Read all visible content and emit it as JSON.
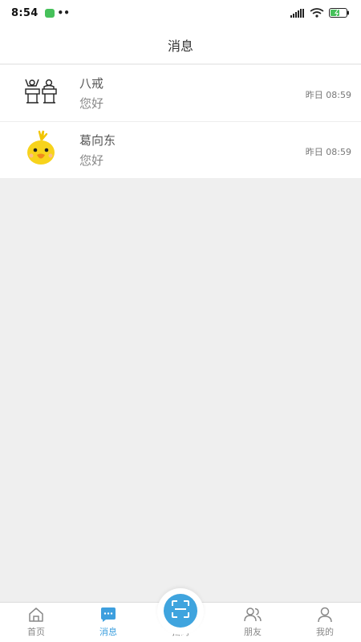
{
  "status_bar": {
    "time": "8:54",
    "dots": "••",
    "accent": "#46c15a"
  },
  "header": {
    "title": "消息"
  },
  "messages": [
    {
      "name": "八戒",
      "preview": "您好",
      "time": "昨日 08:59",
      "avatar_icon": "podium-people-icon"
    },
    {
      "name": "葛向东",
      "preview": "您好",
      "time": "昨日 08:59",
      "avatar_icon": "yellow-bird-icon"
    }
  ],
  "bottom_nav": {
    "active_color": "#3d9fde",
    "items": [
      {
        "label": "首页",
        "icon": "home-icon"
      },
      {
        "label": "消息",
        "icon": "chat-icon",
        "active": true
      },
      {
        "label": "扫码",
        "icon": "scan-icon"
      },
      {
        "label": "朋友",
        "icon": "friends-icon"
      },
      {
        "label": "我的",
        "icon": "user-icon"
      }
    ]
  }
}
